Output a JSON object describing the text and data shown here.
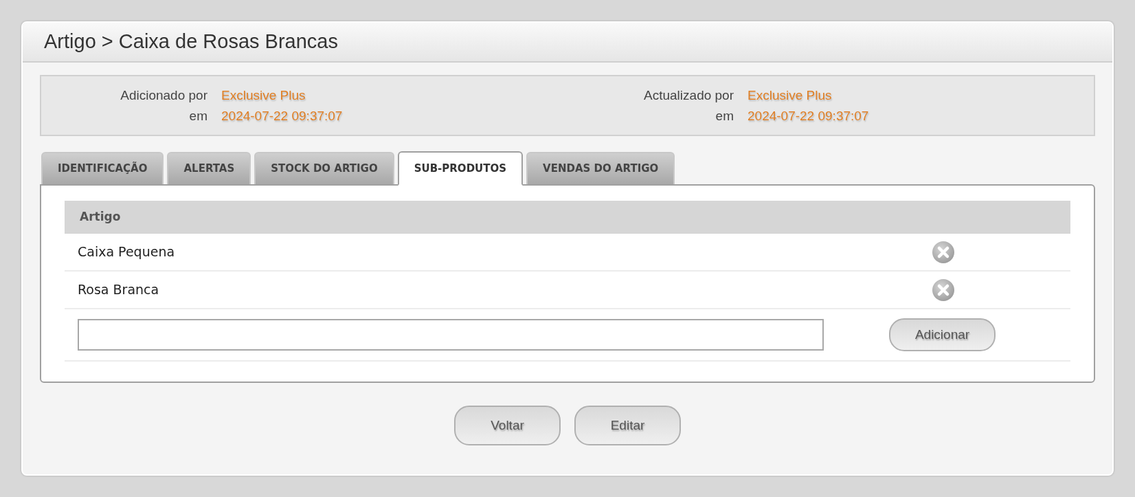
{
  "title": "Artigo > Caixa de Rosas Brancas",
  "audit": [
    {
      "label": "Adicionado por",
      "value": "Exclusive Plus",
      "date_label": "em",
      "date": "2024-07-22 09:37:07"
    },
    {
      "label": "Actualizado por",
      "value": "Exclusive Plus",
      "date_label": "em",
      "date": "2024-07-22 09:37:07"
    }
  ],
  "tabs": [
    {
      "label": "IDENTIFICAÇÃO",
      "selected": false
    },
    {
      "label": "ALERTAS",
      "selected": false
    },
    {
      "label": "STOCK DO ARTIGO",
      "selected": false
    },
    {
      "label": "SUB-PRODUTOS",
      "selected": true
    },
    {
      "label": "VENDAS DO ARTIGO",
      "selected": false
    }
  ],
  "table": {
    "column": "Artigo",
    "rows": [
      {
        "name": "Caixa Pequena"
      },
      {
        "name": "Rosa Branca"
      }
    ]
  },
  "add_button": "Adicionar",
  "buttons": [
    "Voltar",
    "Editar"
  ]
}
